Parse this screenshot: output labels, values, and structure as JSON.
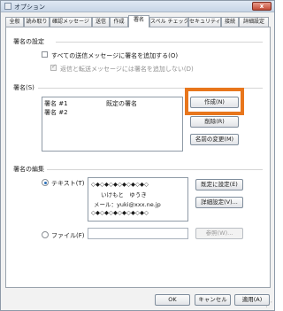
{
  "window": {
    "title": "オプション",
    "close_glyph": "x"
  },
  "tabs": [
    {
      "label": "全般"
    },
    {
      "label": "読み取り"
    },
    {
      "label": "確認メッセージ"
    },
    {
      "label": "送信"
    },
    {
      "label": "作成"
    },
    {
      "label": "署名"
    },
    {
      "label": "スペル チェック"
    },
    {
      "label": "セキュリティ"
    },
    {
      "label": "接続"
    },
    {
      "label": "詳細設定"
    }
  ],
  "settings": {
    "title": "署名の設定",
    "add_to_all": "すべての送信メッセージに署名を追加する(O)",
    "no_reply_forward": "返信と転送メッセージには署名を追加しない(D)"
  },
  "signatures": {
    "title": "署名(S)",
    "rows": [
      {
        "name": "署名 #1",
        "note": "既定の署名"
      },
      {
        "name": "署名 #2",
        "note": ""
      }
    ],
    "new_button": "作成(N)",
    "delete_button": "削除(R)",
    "rename_button": "名前の変更(M)",
    "highlight_color": "#e8761c"
  },
  "edit": {
    "title": "署名の編集",
    "text_option": "テキスト(T)",
    "file_option": "ファイル(F)",
    "signature_lines": [
      "◇◆◇◆◇◆◇◆◇◆◇◆◇",
      "いけもと　ゆうき",
      "メール：yuki@xxx.ne.jp",
      "◇◆◇◆◇◆◇◆◇◆◇◆◇"
    ],
    "set_default_button": "既定に設定(E)",
    "advanced_button": "詳細設定(V)...",
    "browse_button": "参照(W)...",
    "file_value": ""
  },
  "footer": {
    "ok": "OK",
    "cancel": "キャンセル",
    "apply": "適用(A)"
  }
}
